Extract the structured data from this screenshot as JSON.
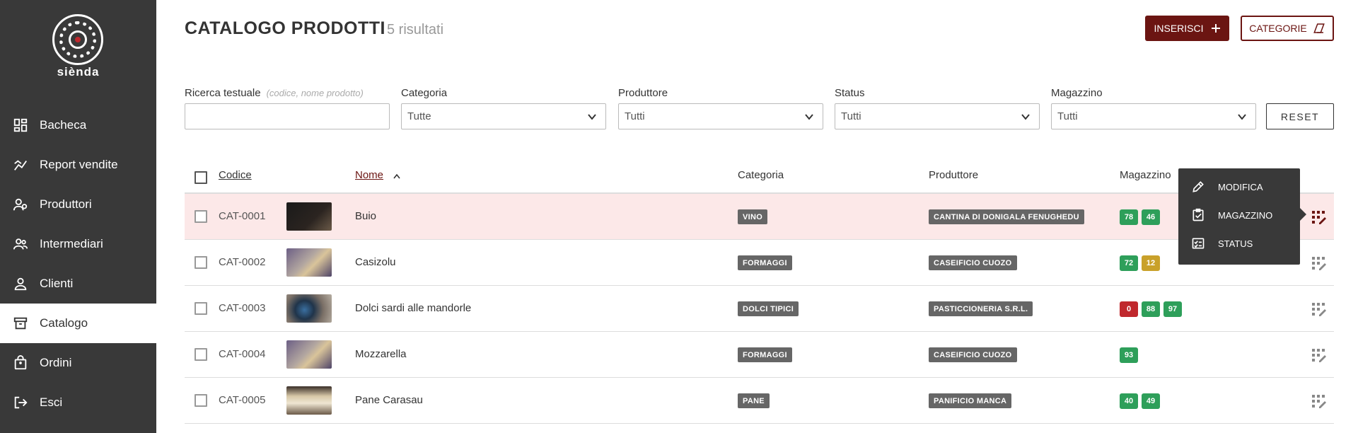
{
  "brand": {
    "name": "siènda"
  },
  "sidebar": {
    "items": [
      {
        "label": "Bacheca",
        "icon": "dashboard-icon"
      },
      {
        "label": "Report vendite",
        "icon": "chart-icon"
      },
      {
        "label": "Produttori",
        "icon": "producers-icon"
      },
      {
        "label": "Intermediari",
        "icon": "people-icon"
      },
      {
        "label": "Clienti",
        "icon": "person-icon"
      },
      {
        "label": "Catalogo",
        "icon": "archive-icon",
        "active": true
      },
      {
        "label": "Ordini",
        "icon": "bag-icon"
      },
      {
        "label": "Esci",
        "icon": "logout-icon"
      }
    ]
  },
  "header": {
    "title": "CATALOGO PRODOTTI",
    "results": "5 risultati",
    "insert_label": "INSERISCI",
    "categories_label": "CATEGORIE"
  },
  "filters": {
    "search_label": "Ricerca testuale",
    "search_hint": "(codice, nome prodotto)",
    "search_value": "",
    "categoria_label": "Categoria",
    "categoria_value": "Tutte",
    "produttore_label": "Produttore",
    "produttore_value": "Tutti",
    "status_label": "Status",
    "status_value": "Tutti",
    "magazzino_label": "Magazzino",
    "magazzino_value": "Tutti",
    "reset_label": "RESET"
  },
  "table": {
    "columns": {
      "code": "Codice",
      "name": "Nome",
      "category": "Categoria",
      "producer": "Produttore",
      "stock": "Magazzino"
    },
    "rows": [
      {
        "code": "CAT-0001",
        "name": "Buio",
        "category": "VINO",
        "producer": "CANTINA DI DONIGALA FENUGHEDU",
        "stock": [
          {
            "value": "78",
            "color": "#2e9f5a"
          },
          {
            "value": "46",
            "color": "#2e9f5a"
          }
        ]
      },
      {
        "code": "CAT-0002",
        "name": "Casizolu",
        "category": "FORMAGGI",
        "producer": "CASEIFICIO CUOZO",
        "stock": [
          {
            "value": "72",
            "color": "#2e9f5a"
          },
          {
            "value": "12",
            "color": "#c9a12a"
          }
        ]
      },
      {
        "code": "CAT-0003",
        "name": "Dolci sardi alle mandorle",
        "category": "DOLCI TIPICI",
        "producer": "PASTICCIONERIA S.R.L.",
        "stock": [
          {
            "value": "0",
            "color": "#c0282d"
          },
          {
            "value": "88",
            "color": "#2e9f5a"
          },
          {
            "value": "97",
            "color": "#2e9f5a"
          }
        ]
      },
      {
        "code": "CAT-0004",
        "name": "Mozzarella",
        "category": "FORMAGGI",
        "producer": "CASEIFICIO CUOZO",
        "stock": [
          {
            "value": "93",
            "color": "#2e9f5a"
          }
        ]
      },
      {
        "code": "CAT-0005",
        "name": "Pane Carasau",
        "category": "PANE",
        "producer": "PANIFICIO MANCA",
        "stock": [
          {
            "value": "40",
            "color": "#2e9f5a"
          },
          {
            "value": "49",
            "color": "#2e9f5a"
          }
        ]
      }
    ]
  },
  "row_menu": {
    "items": [
      {
        "label": "MODIFICA",
        "icon": "pencil-icon"
      },
      {
        "label": "MAGAZZINO",
        "icon": "clipboard-check-icon"
      },
      {
        "label": "STATUS",
        "icon": "checklist-icon"
      }
    ]
  },
  "colors": {
    "brand": "#6b1512",
    "sidebar": "#393939",
    "highlight_row": "#fce8e8"
  }
}
